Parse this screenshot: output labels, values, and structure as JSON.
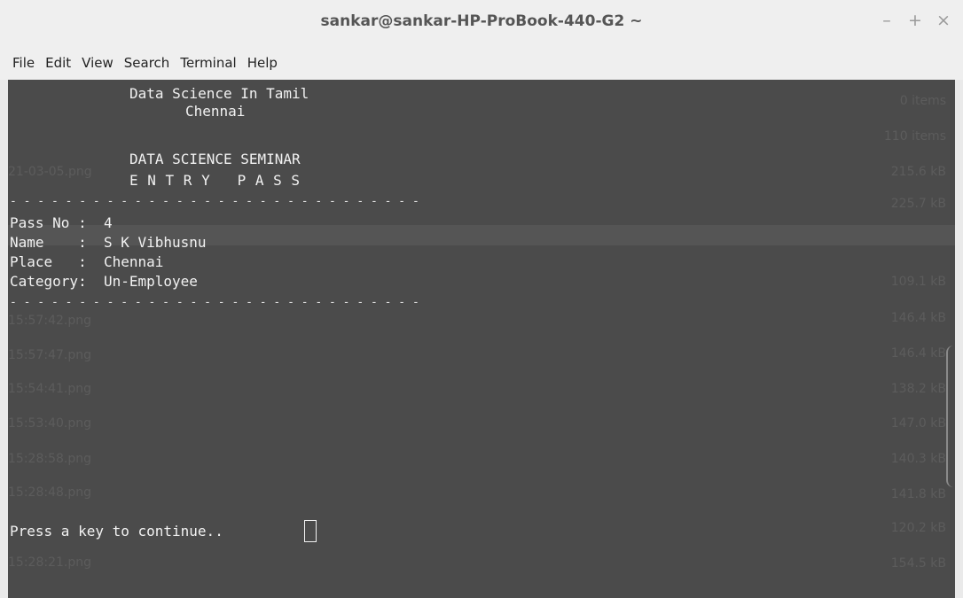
{
  "window": {
    "title": "sankar@sankar-HP-ProBook-440-G2 ~",
    "minimize_glyph": "–",
    "maximize_glyph": "+",
    "close_glyph": "×"
  },
  "menu": {
    "items": [
      "File",
      "Edit",
      "View",
      "Search",
      "Terminal",
      "Help"
    ]
  },
  "terminal": {
    "lines": {
      "org": "Data Science In Tamil",
      "city": "Chennai",
      "event": "DATA SCIENCE SEMINAR",
      "pass_heading": "E N T R Y   P A S S",
      "divider_top": "- - - - - - - - - - - - - - - - - - - - - - - - - - - - - -",
      "pass_no": "Pass No :  4",
      "name": "Name    :  S K Vibhusnu",
      "place": "Place   :  Chennai",
      "category": "Category:  Un-Employee",
      "divider_bottom": "- - - - - - - - - - - - - - - - - - - - - - - - - - - - - -",
      "prompt": "Press a key to continue.."
    }
  },
  "background_ghost": {
    "left": [
      "21-03-05.png",
      "15:57:42.png",
      "15:57:47.png",
      "15:54:41.png",
      "15:53:40.png",
      "15:28:58.png",
      "15:28:48.png",
      "15:28:21.png"
    ],
    "right": [
      "0 items",
      "110 items",
      "215.6 kB",
      "225.7 kB",
      "109.1 kB",
      "146.4 kB",
      "146.4 kB",
      "138.2 kB",
      "147.0 kB",
      "140.3 kB",
      "141.8 kB",
      "120.2 kB",
      "154.5 kB"
    ]
  },
  "colors": {
    "terminal_bg": "#4b4b4b",
    "terminal_fg": "#f2f2f2",
    "titlebar_bg": "#efefef"
  }
}
